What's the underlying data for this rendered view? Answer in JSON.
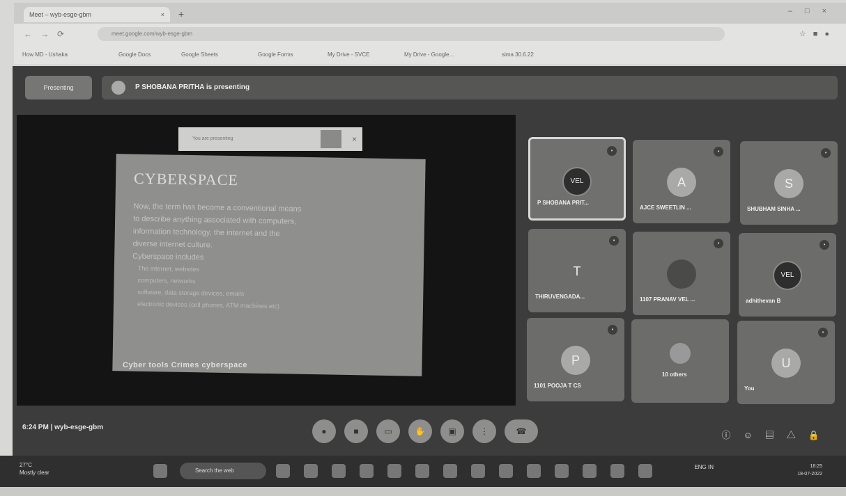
{
  "browser": {
    "tab_title": "Meet – wyb-esge-gbm",
    "url": "meet.google.com/wyb-esge-gbm",
    "bookmarks": [
      "How MD - Ushaka",
      "Google Docs",
      "Google Sheets",
      "Google Forms",
      "My Drive - SVCE",
      "My Drive - Google...",
      "sima 30.6.22"
    ]
  },
  "meet": {
    "present_button": "Presenting",
    "presenting_banner": "P SHOBANA PRITHA is presenting",
    "capture_bar_text": "You are presenting",
    "slide": {
      "title": "CYBERSPACE",
      "lines": [
        "Now, the term has become a conventional means",
        "to describe anything associated with computers,",
        "information technology, the internet and the",
        "diverse internet culture.",
        "Cyberspace includes",
        "The internet, websites",
        "computers, networks",
        "software, data storage devices, emails",
        "electronic devices (cell phones, ATM machines etc)"
      ],
      "caption": "Cyber tools Crimes cyberspace"
    },
    "tiles": [
      {
        "name": "P SHOBANA PRIT...",
        "initial": "VEL",
        "active": true
      },
      {
        "name": "AJCE SWEETLIN ...",
        "initial": "A"
      },
      {
        "name": "SHUBHAM SINHA ...",
        "initial": "S"
      },
      {
        "name": "THIRUVENGADA...",
        "initial": "T"
      },
      {
        "name": "1107 PRANAV VEL ...",
        "initial": ""
      },
      {
        "name": "adhithevan B",
        "initial": "VEL"
      },
      {
        "name": "1101 POOJA T CS",
        "initial": "P"
      },
      {
        "name": "10 others",
        "initial": ""
      },
      {
        "name": "You",
        "initial": "U"
      }
    ],
    "time": "6:24 PM",
    "meeting_code": "wyb-esge-gbm",
    "controls": [
      "mic-icon",
      "camera-icon",
      "captions-icon",
      "hand-icon",
      "present-icon",
      "more-icon",
      "end-call-icon"
    ],
    "right_controls": [
      "info-icon",
      "people-icon",
      "chat-icon",
      "activities-icon",
      "lock-icon"
    ]
  },
  "taskbar": {
    "weather_temp": "27°C",
    "weather_desc": "Mostly clear",
    "search_placeholder": "Search the web",
    "lang": "ENG IN",
    "time": "18:25",
    "date": "18-07-2022"
  }
}
